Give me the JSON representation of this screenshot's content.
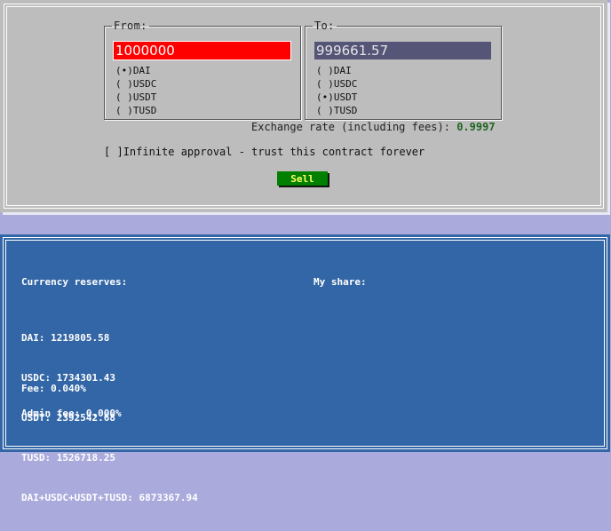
{
  "swap": {
    "from": {
      "legend": "From:",
      "amount": "1000000",
      "options": [
        {
          "marker": "(•)",
          "label": "DAI"
        },
        {
          "marker": "( )",
          "label": "USDC"
        },
        {
          "marker": "( )",
          "label": "USDT"
        },
        {
          "marker": "( )",
          "label": "TUSD"
        }
      ]
    },
    "to": {
      "legend": "To:",
      "amount": "999661.57",
      "options": [
        {
          "marker": "( )",
          "label": "DAI"
        },
        {
          "marker": "( )",
          "label": "USDC"
        },
        {
          "marker": "(•)",
          "label": "USDT"
        },
        {
          "marker": "( )",
          "label": "TUSD"
        }
      ]
    },
    "exchange_rate_label": "Exchange rate (including fees):",
    "exchange_rate_value": "0.9997",
    "infinite_approval_box": "[ ]",
    "infinite_approval_label": "Infinite approval - trust this contract forever",
    "sell_label": "Sell",
    "colors": {
      "from_field_bg": "#ff0000",
      "to_field_bg": "#555578",
      "sell_button_bg": "#008000",
      "sell_button_text": "#ffff66",
      "rate_value": "#226622"
    }
  },
  "stats": {
    "reserves_title": "Currency reserves:",
    "my_share_title": "My share:",
    "reserves": [
      {
        "name": "DAI:",
        "value": "1219805.58"
      },
      {
        "name": "USDC:",
        "value": "1734301.43"
      },
      {
        "name": "USDT:",
        "value": "2392542.68"
      },
      {
        "name": "TUSD:",
        "value": "1526718.25"
      },
      {
        "name": "DAI+USDC+USDT+TUSD:",
        "value": "6873367.94"
      }
    ],
    "fee_label": "Fee:",
    "fee_value": "0.040%",
    "admin_fee_label": "Admin fee:",
    "admin_fee_value": "0.000%",
    "panel_color": "#3366a6"
  }
}
